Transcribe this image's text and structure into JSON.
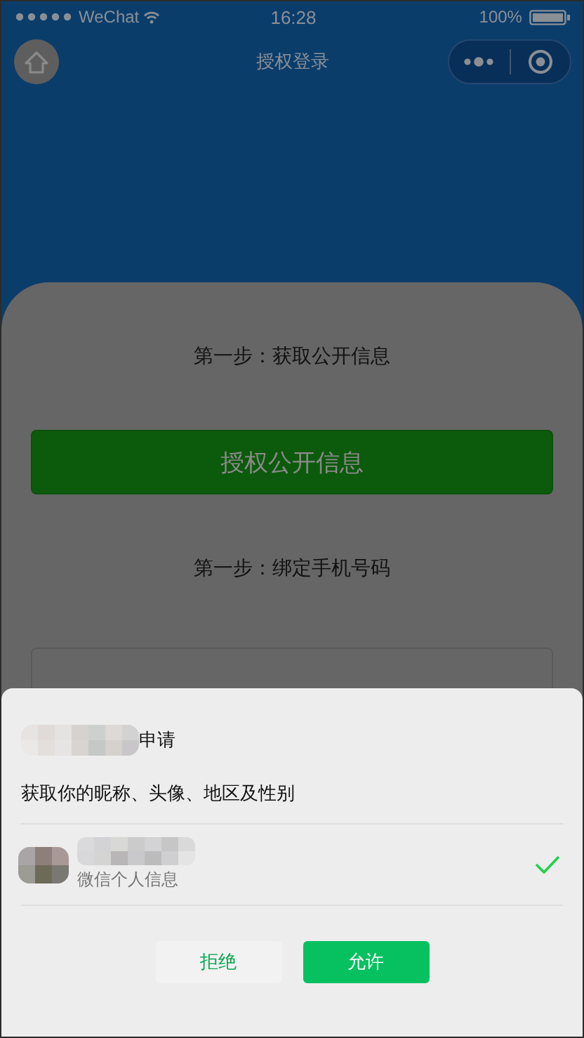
{
  "status_bar": {
    "carrier": "WeChat",
    "time": "16:28",
    "battery": "100%"
  },
  "nav_bar": {
    "title": "授权登录"
  },
  "steps": [
    {
      "label": "第一步：获取公开信息",
      "button": "授权公开信息",
      "kind": "filled"
    },
    {
      "label": "第一步：绑定手机号码",
      "kind": "outlined"
    }
  ],
  "auth_sheet": {
    "request": "申请",
    "scope": "获取你的昵称、头像、地区及性别",
    "accounts": [
      {
        "caption": "微信个人信息",
        "selected": true
      }
    ],
    "buttons": [
      {
        "label": "拒绝",
        "kind": "secondary"
      },
      {
        "label": "允许",
        "kind": "primary"
      }
    ]
  }
}
